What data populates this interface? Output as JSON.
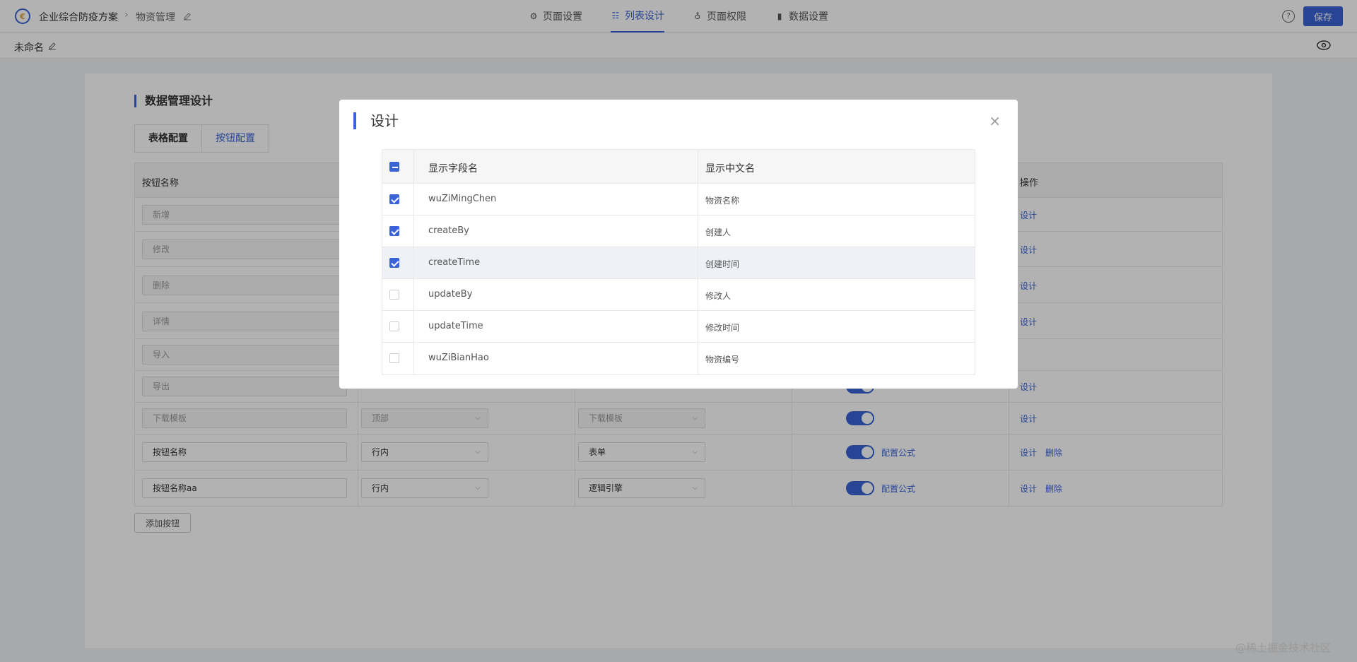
{
  "header": {
    "app_name": "企业综合防疫方案",
    "module_name": "物资管理",
    "nav": [
      {
        "label": "页面设置",
        "icon": "gear-icon"
      },
      {
        "label": "列表设计",
        "icon": "list-icon"
      },
      {
        "label": "页面权限",
        "icon": "permission-icon"
      },
      {
        "label": "数据设置",
        "icon": "chart-icon"
      }
    ],
    "help_label": "?",
    "save_label": "保存"
  },
  "subbar": {
    "title": "未命名"
  },
  "main": {
    "section_title": "数据管理设计",
    "tabs": [
      "表格配置",
      "按钮配置"
    ],
    "columns": {
      "name": "按钮名称",
      "action": "操作"
    },
    "rows": [
      {
        "name": "新增",
        "position": "",
        "type": "",
        "action1": "设计",
        "action2": ""
      },
      {
        "name": "修改",
        "position": "",
        "type": "",
        "action1": "设计",
        "action2": ""
      },
      {
        "name": "删除",
        "position": "",
        "type": "",
        "action1": "设计",
        "action2": ""
      },
      {
        "name": "详情",
        "position": "",
        "type": "",
        "action1": "设计",
        "action2": ""
      },
      {
        "name": "导入",
        "position": "",
        "type": "",
        "action1": "",
        "action2": ""
      },
      {
        "name": "导出",
        "position": "",
        "type": "",
        "action1": "设计",
        "action2": ""
      },
      {
        "name": "下载模板",
        "position": "顶部",
        "type": "下载模板",
        "action1": "设计",
        "action2": ""
      },
      {
        "name": "按钮名称",
        "position": "行内",
        "type": "表单",
        "formula": "配置公式",
        "action1": "设计",
        "action2": "删除"
      },
      {
        "name": "按钮名称aa",
        "position": "行内",
        "type": "逻辑引擎",
        "formula": "配置公式",
        "action1": "设计",
        "action2": "删除"
      }
    ],
    "add_button_label": "添加按钮"
  },
  "modal": {
    "title": "设计",
    "close_label": "×",
    "headers": {
      "field": "显示字段名",
      "label": "显示中文名"
    },
    "rows": [
      {
        "field": "wuZiMingChen",
        "label": "物资名称",
        "checked": true
      },
      {
        "field": "createBy",
        "label": "创建人",
        "checked": true
      },
      {
        "field": "createTime",
        "label": "创建时间",
        "checked": true
      },
      {
        "field": "updateBy",
        "label": "修改人",
        "checked": false
      },
      {
        "field": "updateTime",
        "label": "修改时间",
        "checked": false
      },
      {
        "field": "wuZiBianHao",
        "label": "物资编号",
        "checked": false
      }
    ]
  },
  "watermark": "@稀土掘金技术社区",
  "colors": {
    "accent": "#3a63d6"
  }
}
